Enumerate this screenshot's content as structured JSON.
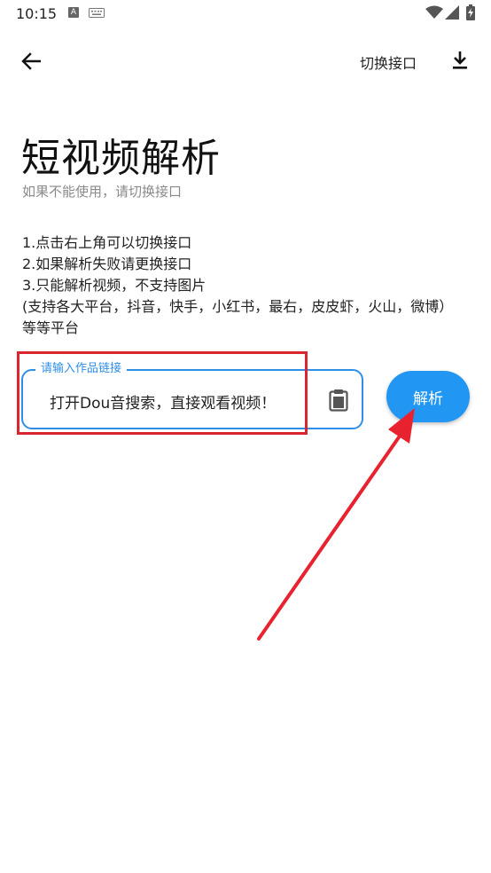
{
  "statusbar": {
    "time": "10:15",
    "a_icon_glyph": "A",
    "icons": [
      "a-icon",
      "keyboard-icon",
      "wifi-icon",
      "signal-icon",
      "battery-icon"
    ]
  },
  "toolbar": {
    "switch_api_label": "切换接口",
    "icons": [
      "back-arrow-icon",
      "download-icon"
    ]
  },
  "header": {
    "title": "短视频解析",
    "subtitle": "如果不能使用，请切换接口"
  },
  "instructions": [
    "1.点击右上角可以切换接口",
    "2.如果解析失败请更换接口",
    "3.只能解析视频，不支持图片",
    "(支持各大平台，抖音，快手，小红书，最右，皮皮虾，火山，微博）等等平台"
  ],
  "link_field": {
    "label": "请输入作品链接",
    "value": "打开Dou音搜索，直接观看视频！",
    "paste_icon": "clipboard-icon"
  },
  "parse_button": {
    "label": "解析"
  },
  "colors": {
    "accent": "#2196f3",
    "field_border": "#2f8fe8",
    "annotation": "#d9252f"
  }
}
